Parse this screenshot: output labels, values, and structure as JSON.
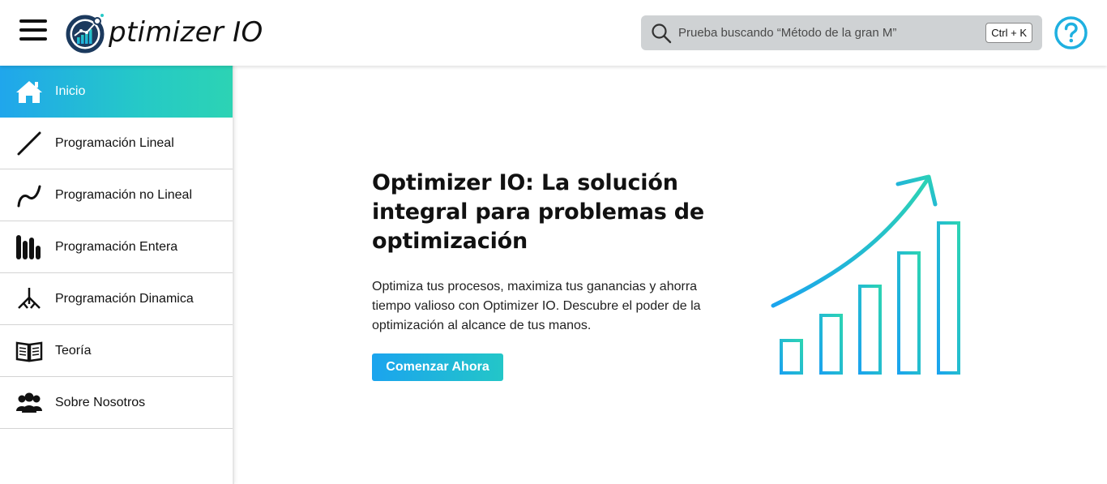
{
  "header": {
    "logo_text": "ptimizer IO",
    "search": {
      "placeholder": "Prueba buscando “Método de la gran M”",
      "shortcut": "Ctrl + K"
    },
    "icons": {
      "menu": "hamburger-icon",
      "search": "search-icon",
      "help": "help-circle-icon"
    }
  },
  "sidebar": {
    "items": [
      {
        "label": "Inicio",
        "icon": "home-icon",
        "active": true
      },
      {
        "label": "Programación Lineal",
        "icon": "line-icon"
      },
      {
        "label": "Programación no Lineal",
        "icon": "curve-icon"
      },
      {
        "label": "Programación Entera",
        "icon": "bars-icon"
      },
      {
        "label": "Programación Dinamica",
        "icon": "tree-icon"
      },
      {
        "label": "Teoría",
        "icon": "book-icon"
      },
      {
        "label": "Sobre Nosotros",
        "icon": "users-icon"
      }
    ]
  },
  "main": {
    "title": "Optimizer IO: La solución integral para problemas de optimización",
    "description": "Optimiza tus procesos, maximiza tus ganancias y ahorra tiempo valioso con Optimizer IO. Descubre el poder de la optimización al alcance de tus manos.",
    "cta_label": "Comenzar Ahora",
    "illustration": "growth-chart-illustration"
  },
  "colors": {
    "accent_start": "#1ba4ee",
    "accent_end": "#2cd3b4",
    "help_icon": "#1fb0e0",
    "search_bg": "#cfd2d4"
  }
}
